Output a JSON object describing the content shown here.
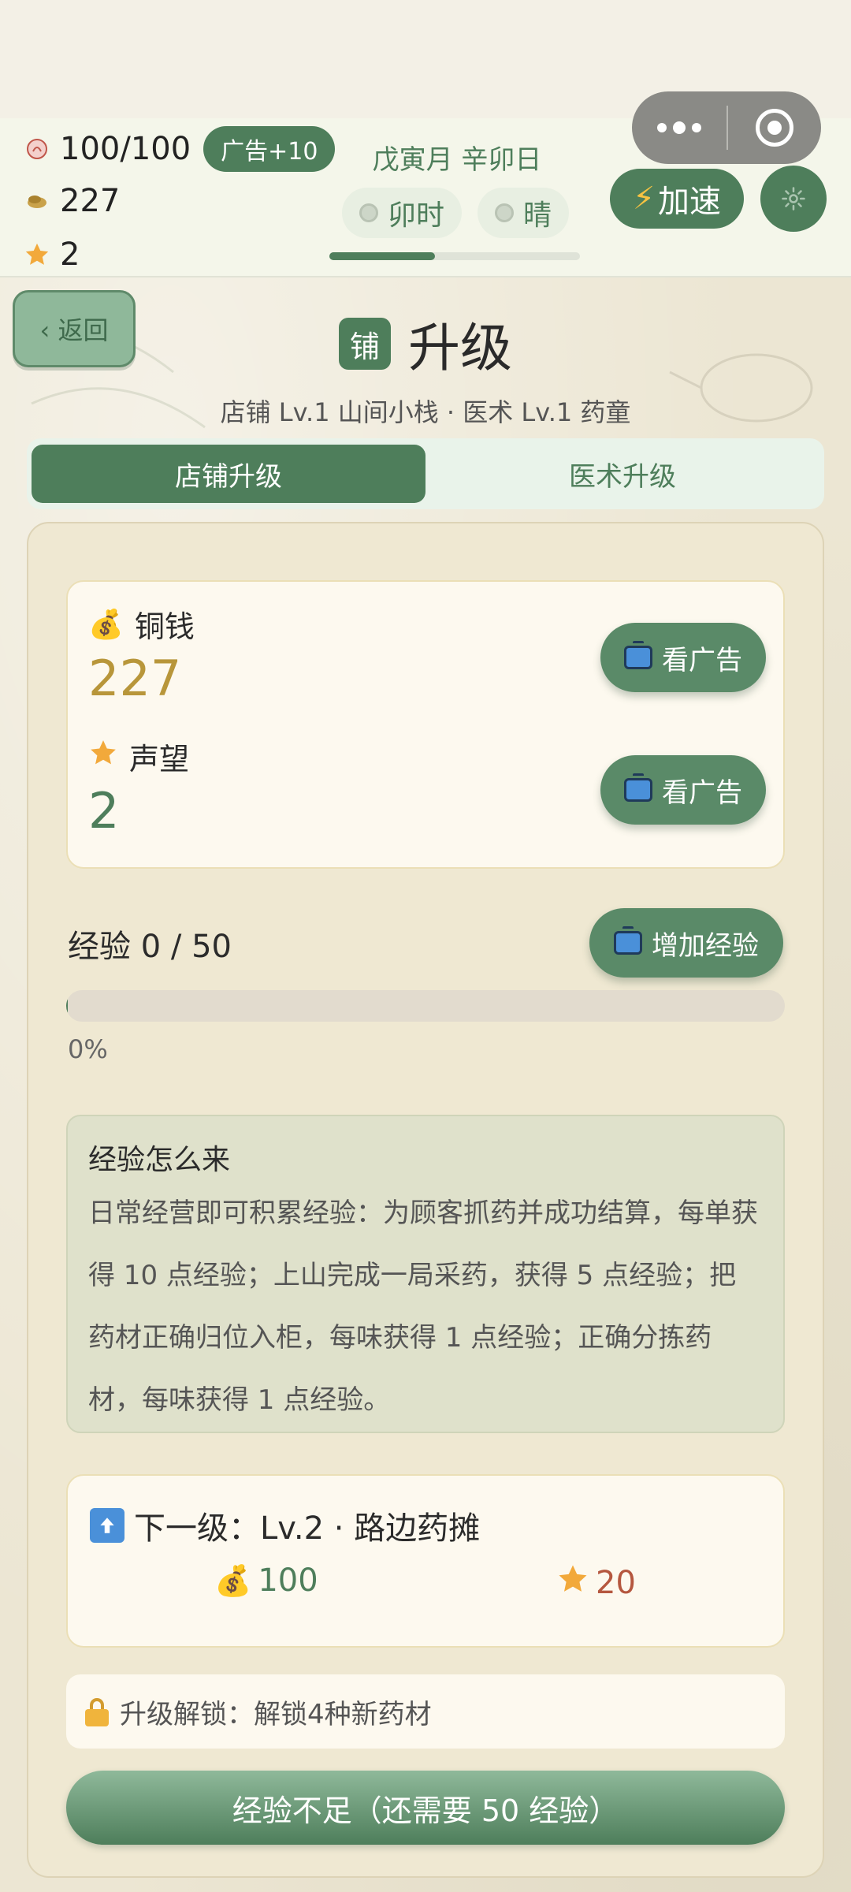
{
  "status": {
    "stamina": "100/100",
    "ad_bonus": "广告+10",
    "coins": "227",
    "reputation": "2",
    "date": "戊寅月 辛卯日",
    "time_chip": "卯时",
    "weather_chip": "晴",
    "day_progress": 0.42,
    "speed_label": "加速"
  },
  "header": {
    "back_label": "‹ 返回",
    "badge": "铺",
    "title": "升级",
    "subtitle": "店铺 Lv.1 山间小栈 · 医术 Lv.1 药童"
  },
  "tabs": [
    {
      "label": "店铺升级",
      "active": true
    },
    {
      "label": "医术升级",
      "active": false
    }
  ],
  "wallet": {
    "coins_label": "铜钱",
    "coins_value": "227",
    "reputation_label": "声望",
    "reputation_value": "2",
    "ad_label": "看广告"
  },
  "experience": {
    "label": "经验 0 / 50",
    "add_label": "增加经验",
    "progress": 0,
    "percent_text": "0%"
  },
  "info": {
    "title": "经验怎么来",
    "body": "日常经营即可积累经验：为顾客抓药并成功结算，每单获得 10 点经验；上山完成一局采药，获得 5 点经验；把药材正确归位入柜，每味获得 1 点经验；正确分拣药材，每味获得 1 点经验。"
  },
  "next_level": {
    "title": "下一级：Lv.2 · 路边药摊",
    "coin_cost": "100",
    "reputation_cost": "20"
  },
  "unlock": {
    "text": "升级解锁：解锁4种新药材"
  },
  "submit": {
    "label": "经验不足（还需要 50 经验）"
  },
  "colors": {
    "primary_green": "#4e7e5b",
    "coin_gold": "#b8963a",
    "rep_red": "#b5573f"
  },
  "icons": [
    "stamina-icon",
    "coin-icon",
    "star-icon",
    "tv-icon",
    "settings-icon",
    "arrow-up-icon",
    "lock-icon",
    "money-bag-icon"
  ]
}
